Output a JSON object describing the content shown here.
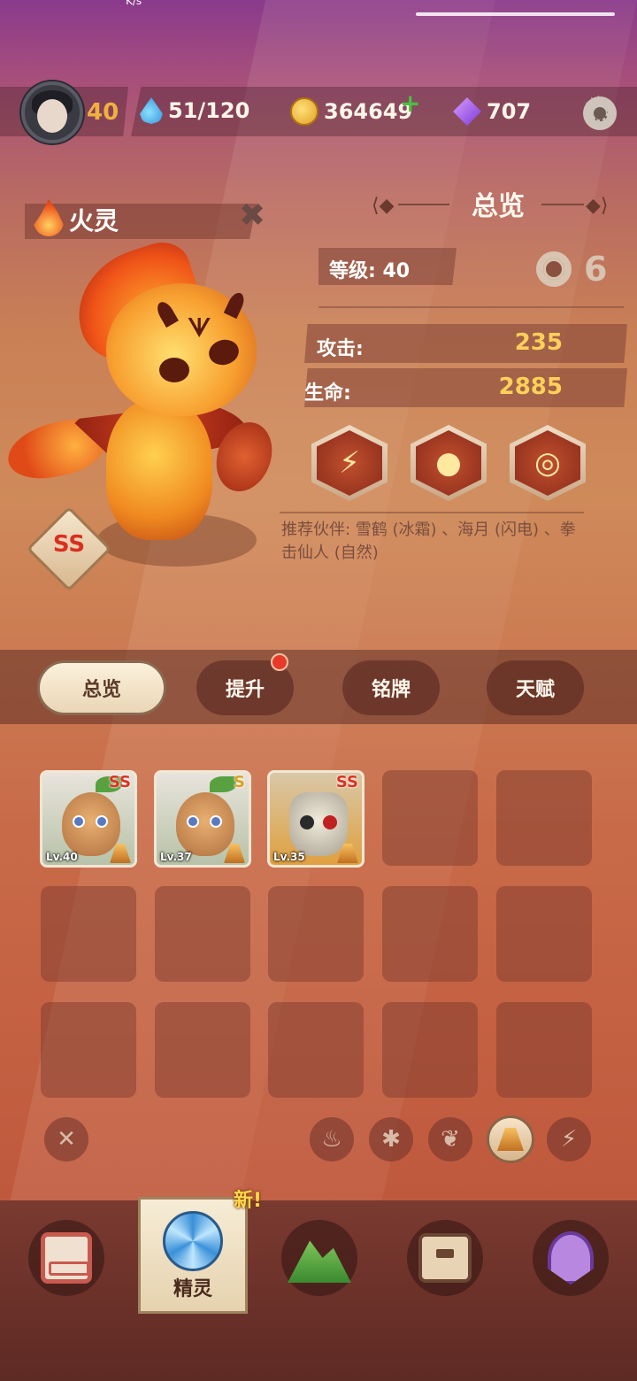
{
  "statusbar": {
    "speed_text": "K/s"
  },
  "player": {
    "level": "40"
  },
  "resources": {
    "energy": "51/120",
    "coins": "364649",
    "gems": "707"
  },
  "creature": {
    "name": "火灵",
    "element": "fire",
    "rank": "SS"
  },
  "overview": {
    "title": "总览",
    "level_label": "等级: 40",
    "lock_glyph": "6",
    "stats": [
      {
        "label": "攻击:",
        "value": "235"
      },
      {
        "label": "生命:",
        "value": "2885"
      }
    ],
    "skills": [
      {
        "glyph": "⚡",
        "icon": "slash-skill-icon"
      },
      {
        "glyph": "●",
        "icon": "droplet-skill-icon"
      },
      {
        "glyph": "◎",
        "icon": "swirl-skill-icon"
      }
    ],
    "recommend": "推荐伙伴: 雪鹤 (冰霜) 、海月 (闪电) 、拳击仙人 (自然)"
  },
  "tabs": [
    {
      "label": "总览",
      "active": true
    },
    {
      "label": "提升",
      "has_notice": true
    },
    {
      "label": "铭牌"
    },
    {
      "label": "天赋"
    }
  ],
  "inventory": [
    {
      "level": "Lv.40",
      "rank": "SS",
      "kind": "sprout"
    },
    {
      "level": "Lv.37",
      "rank": "S",
      "kind": "sprout"
    },
    {
      "level": "Lv.35",
      "rank": "SS",
      "kind": "skull"
    }
  ],
  "filters": [
    {
      "name": "clear",
      "glyph": "✕"
    },
    {
      "name": "fire",
      "glyph": "♨"
    },
    {
      "name": "ice",
      "glyph": "✱"
    },
    {
      "name": "nature",
      "glyph": "❦"
    },
    {
      "name": "earth",
      "glyph": "",
      "active": true
    },
    {
      "name": "lightning",
      "glyph": "⚡"
    }
  ],
  "bottom_nav": {
    "active_label": "精灵",
    "new_badge": "新!"
  },
  "colors": {
    "accent_gold": "#ffd05a",
    "rank_red": "#e03020",
    "notice_red": "#e83a2a"
  }
}
